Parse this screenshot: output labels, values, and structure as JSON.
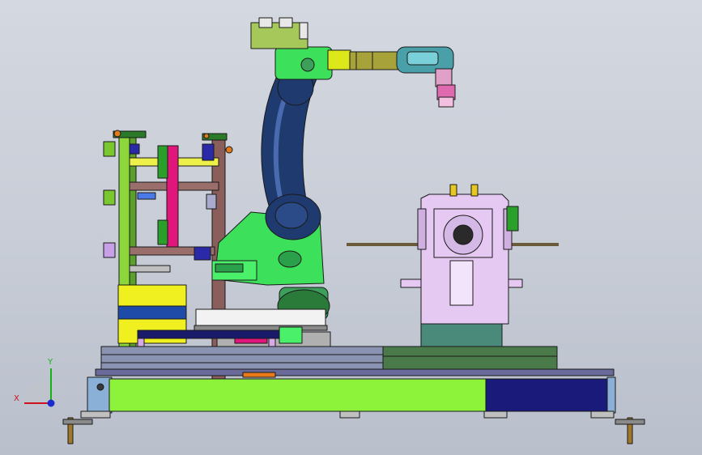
{
  "triad": {
    "x_label": "X",
    "y_label": "Y",
    "x_color": "#d0101c",
    "y_color": "#14b414",
    "z_color": "#1a2acc"
  },
  "palette": {
    "robot_arm": "#1e3a6e",
    "robot_base": "#3de05a",
    "wrist": "#a8a23a",
    "positioner": "#e6c9f2",
    "base_frame": "#8cf23a",
    "rails": "#8a94b2",
    "outline": "#1a1a1a"
  }
}
